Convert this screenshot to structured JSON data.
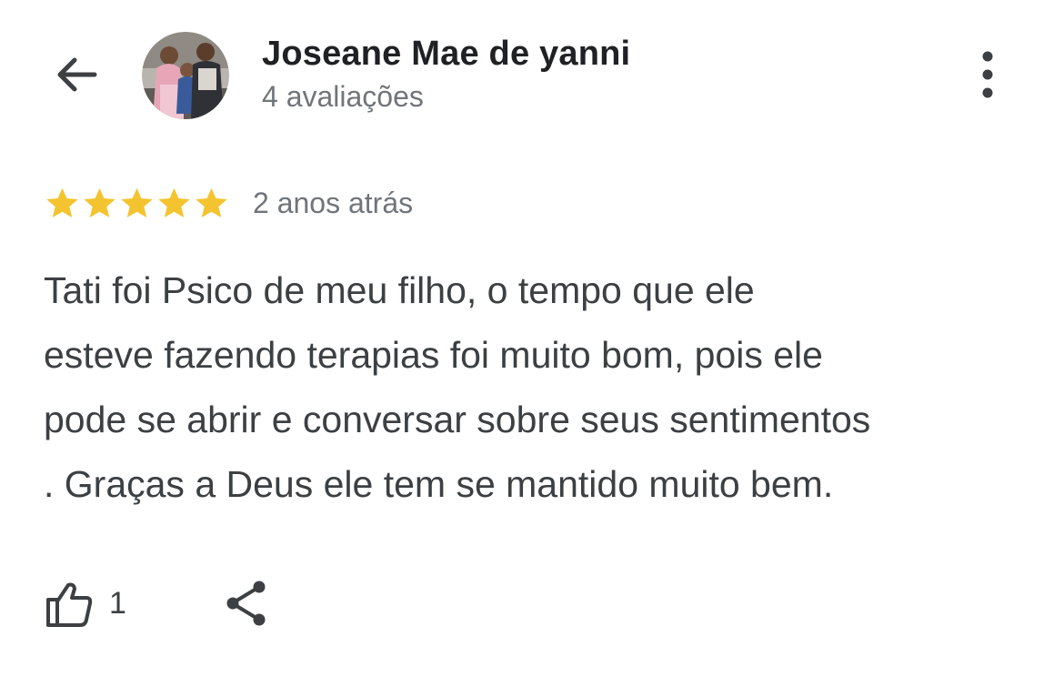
{
  "header": {
    "back_icon": "arrow-back-icon",
    "avatar": "profile-photo",
    "author_name": "Joseane Mae de yanni",
    "review_count": "4 avaliações",
    "more_icon": "more-vertical-icon"
  },
  "review": {
    "rating": 5,
    "rating_max": 5,
    "star_color": "#f4c430",
    "time_ago": "2 anos atrás",
    "lines": [
      "Tati foi Psico de meu filho, o tempo que ele",
      "esteve fazendo terapias foi muito bom, pois ele",
      "pode se abrir e conversar sobre seus sentimentos",
      ". Graças a Deus ele tem se mantido muito bem."
    ]
  },
  "actions": {
    "like_icon": "thumb-up-icon",
    "like_count": "1",
    "share_icon": "share-icon"
  }
}
